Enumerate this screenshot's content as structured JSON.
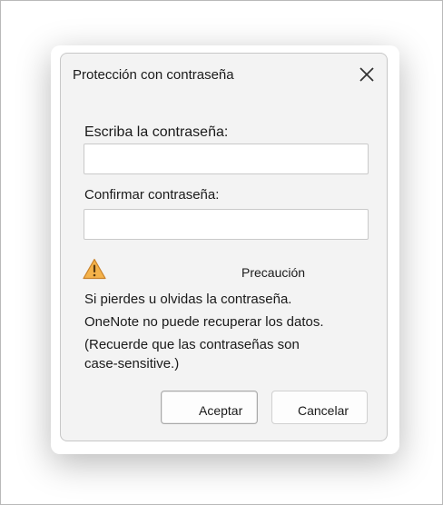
{
  "dialog": {
    "title": "Protección con contraseña",
    "close_icon": "close-icon",
    "password_label": "Escriba la contraseña:",
    "password_value": "",
    "confirm_label": "Confirmar contraseña:",
    "confirm_value": "",
    "warning": {
      "icon": "warning-icon",
      "icon_color": "#e8a33a",
      "title": "Precaución",
      "lines": [
        "Si pierdes u olvidas la contraseña.",
        "OneNote no puede recuperar los datos.",
        "(Recuerde que las contraseñas son",
        "case-sensitive.)"
      ]
    },
    "buttons": {
      "ok_label": "Aceptar",
      "cancel_label": "Cancelar"
    }
  }
}
